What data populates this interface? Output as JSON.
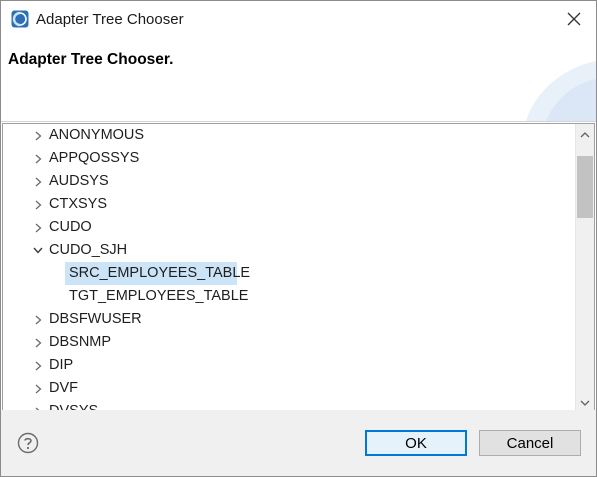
{
  "window": {
    "title": "Adapter Tree Chooser",
    "app_icon": "eclipse-app-icon",
    "close_icon": "close-icon"
  },
  "header": {
    "title": "Adapter Tree Chooser."
  },
  "tree": {
    "nodes": [
      {
        "label": "ANONYMOUS",
        "expanded": false,
        "level": 0
      },
      {
        "label": "APPQOSSYS",
        "expanded": false,
        "level": 0
      },
      {
        "label": "AUDSYS",
        "expanded": false,
        "level": 0
      },
      {
        "label": "CTXSYS",
        "expanded": false,
        "level": 0
      },
      {
        "label": "CUDO",
        "expanded": false,
        "level": 0
      },
      {
        "label": "CUDO_SJH",
        "expanded": true,
        "level": 0
      },
      {
        "label": "SRC_EMPLOYEES_TABLE",
        "level": 1,
        "selected": true
      },
      {
        "label": "TGT_EMPLOYEES_TABLE",
        "level": 1,
        "selected": false
      },
      {
        "label": "DBSFWUSER",
        "expanded": false,
        "level": 0
      },
      {
        "label": "DBSNMP",
        "expanded": false,
        "level": 0
      },
      {
        "label": "DIP",
        "expanded": false,
        "level": 0
      },
      {
        "label": "DVF",
        "expanded": false,
        "level": 0
      },
      {
        "label": "DVSYS",
        "expanded": false,
        "level": 0
      }
    ],
    "selection_color": "#cce4f7"
  },
  "footer": {
    "help_icon": "help-icon",
    "ok_label": "OK",
    "cancel_label": "Cancel"
  },
  "colors": {
    "accent": "#0078d7",
    "footer_bg": "#f0f0f0"
  }
}
